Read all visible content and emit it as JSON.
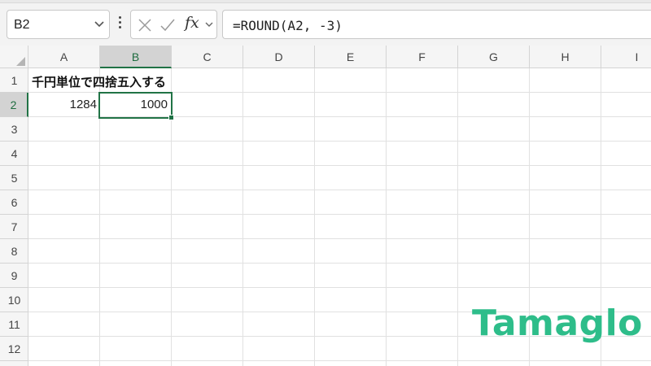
{
  "formula_bar": {
    "name_box": "B2",
    "fx_label": "fx",
    "formula": "=ROUND(A2, -3)"
  },
  "columns": [
    "A",
    "B",
    "C",
    "D",
    "E",
    "F",
    "G",
    "H",
    "I"
  ],
  "selected_column": "B",
  "rows": [
    "1",
    "2",
    "3",
    "4",
    "5",
    "6",
    "7",
    "8",
    "9",
    "10",
    "11",
    "12"
  ],
  "selected_row": "2",
  "cells": {
    "A1": "千円単位で四捨五入する",
    "A2": "1284",
    "B2": "1000"
  },
  "watermark": {
    "text": "Tamaglo",
    "color": "#2ebd8a"
  },
  "colors": {
    "accent": "#217346",
    "header_bg": "#f5f5f5",
    "header_selected_bg": "#d3d3d3"
  }
}
